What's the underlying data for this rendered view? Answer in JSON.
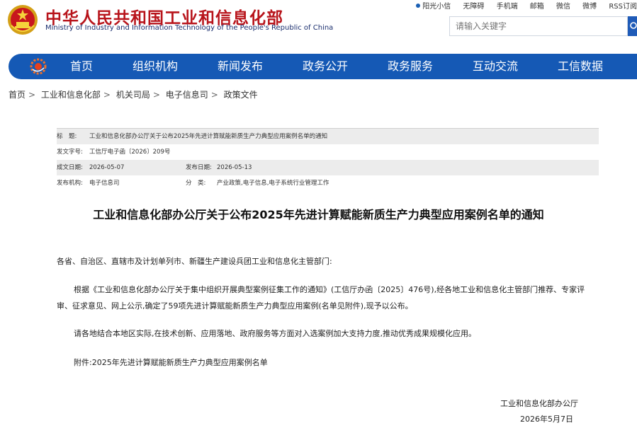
{
  "header": {
    "title": "中华人民共和国工业和信息化部",
    "subtitle": "Ministry of Industry and Information Technology of the People's Republic of China",
    "top_links": [
      "阳光小信",
      "无障碍",
      "手机端",
      "邮箱",
      "微信",
      "微博",
      "RSS订阅"
    ],
    "search_placeholder": "请输入关键字"
  },
  "nav": {
    "items": [
      "首页",
      "组织机构",
      "新闻发布",
      "政务公开",
      "政务服务",
      "互动交流",
      "工信数据"
    ]
  },
  "breadcrumb": [
    "首页",
    "工业和信息化部",
    "机关司局",
    "电子信息司",
    "政策文件"
  ],
  "meta": {
    "title_label": "标　题:",
    "title_value": "工业和信息化部办公厅关于公布2025年先进计算赋能新质生产力典型应用案例名单的通知",
    "doc_no_label": "发文字号:",
    "doc_no_value": "工信厅电子函〔2026〕209号",
    "written_label": "成文日期:",
    "written_value": "2026-05-07",
    "published_label": "发布日期:",
    "published_value": "2026-05-13",
    "org_label": "发布机构:",
    "org_value": "电子信息司",
    "category_label": "分　类:",
    "category_value": "产业政策,电子信息,电子系统行业管理工作"
  },
  "article": {
    "title": "工业和信息化部办公厅关于公布2025年先进计算赋能新质生产力典型应用案例名单的通知",
    "addressee": "各省、自治区、直辖市及计划单列市、新疆生产建设兵团工业和信息化主管部门:",
    "paragraph1": "根据《工业和信息化部办公厅关于集中组织开展典型案例征集工作的通知》(工信厅办函〔2025〕476号),经各地工业和信息化主管部门推荐、专家评审、征求意见、网上公示,确定了59项先进计算赋能新质生产力典型应用案例(名单见附件),现予以公布。",
    "paragraph2": "请各地结合本地区实际,在技术创新、应用落地、政府服务等方面对入选案例加大支持力度,推动优秀成果规模化应用。",
    "attachment": "附件:2025年先进计算赋能新质生产力典型应用案例名单",
    "signature_org": "工业和信息化部办公厅",
    "signature_date": "2026年5月7日"
  },
  "colors": {
    "brand_red": "#b8141b",
    "nav_blue": "#1559b5",
    "subtitle_blue": "#1a2e6e"
  }
}
